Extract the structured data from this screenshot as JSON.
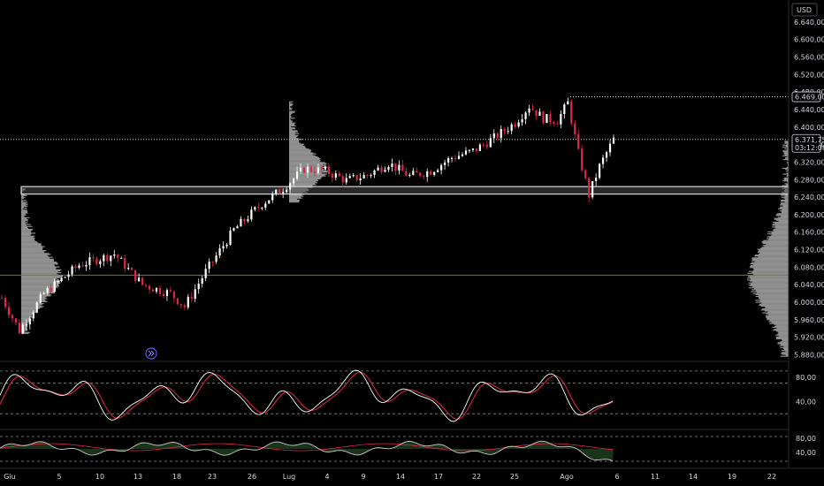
{
  "currency_button": "USD",
  "colors": {
    "background": "#000000",
    "up": "#ffffff",
    "down": "#e0274a",
    "volume_profile": "#bdbdbd",
    "poc_line": "#7a7a2a",
    "stoch_k": "#ffffff",
    "stoch_d": "#e0274a",
    "osc2_line": "#c8c8c8",
    "osc2_signal": "#e0274a",
    "osc2_fill": "#1d3a1d",
    "axis_text": "#d1d4dc"
  },
  "chart_data": [
    {
      "type": "candlestick",
      "title": "",
      "x_tick_labels": [
        "Giu",
        "5",
        "10",
        "13",
        "18",
        "23",
        "26",
        "Lug",
        "4",
        "9",
        "14",
        "17",
        "22",
        "25",
        "Ago",
        "6",
        "11",
        "14",
        "19",
        "22"
      ],
      "y_tick_labels": [
        "6.640,00",
        "6.600,00",
        "6.560,00",
        "6.520,00",
        "6.480,00",
        "6.440,00",
        "6.400,00",
        "6.360,00",
        "6.320,00",
        "6.280,00",
        "6.240,00",
        "6.200,00",
        "6.160,00",
        "6.120,00",
        "6.080,00",
        "6.040,00",
        "6.000,00",
        "5.960,00",
        "5.920,00",
        "5.880,00"
      ],
      "y_ticks": [
        6640,
        6600,
        6560,
        6520,
        6480,
        6440,
        6400,
        6360,
        6320,
        6280,
        6240,
        6200,
        6160,
        6120,
        6080,
        6040,
        6000,
        5960,
        5920,
        5880
      ],
      "ylim": [
        5867,
        6690
      ],
      "reference_lines": [
        {
          "value": 6469,
          "label": "6.469,00",
          "style": "dotted"
        },
        {
          "value": 6371.75,
          "label": "6.371,75",
          "sublabel": "03:12:08",
          "style": "dotted"
        }
      ],
      "value_area_band": [
        6247,
        6264
      ],
      "poc_level": 6062,
      "anchors": [
        {
          "i": 0,
          "p": 6010
        },
        {
          "i": 5,
          "p": 5935
        },
        {
          "i": 12,
          "p": 6020
        },
        {
          "i": 22,
          "p": 6085
        },
        {
          "i": 32,
          "p": 6110
        },
        {
          "i": 40,
          "p": 6040
        },
        {
          "i": 48,
          "p": 6020
        },
        {
          "i": 52,
          "p": 5990
        },
        {
          "i": 58,
          "p": 6070
        },
        {
          "i": 66,
          "p": 6165
        },
        {
          "i": 74,
          "p": 6225
        },
        {
          "i": 80,
          "p": 6260
        },
        {
          "i": 86,
          "p": 6305
        },
        {
          "i": 92,
          "p": 6300
        },
        {
          "i": 98,
          "p": 6278
        },
        {
          "i": 104,
          "p": 6290
        },
        {
          "i": 110,
          "p": 6318
        },
        {
          "i": 116,
          "p": 6288
        },
        {
          "i": 122,
          "p": 6300
        },
        {
          "i": 128,
          "p": 6330
        },
        {
          "i": 134,
          "p": 6345
        },
        {
          "i": 140,
          "p": 6375
        },
        {
          "i": 146,
          "p": 6410
        },
        {
          "i": 150,
          "p": 6448
        },
        {
          "i": 154,
          "p": 6420
        },
        {
          "i": 158,
          "p": 6415
        },
        {
          "i": 161,
          "p": 6455
        },
        {
          "i": 164,
          "p": 6340
        },
        {
          "i": 167,
          "p": 6245
        },
        {
          "i": 170,
          "p": 6310
        },
        {
          "i": 174,
          "p": 6372
        }
      ]
    },
    {
      "type": "line",
      "title": "",
      "y_tick_labels": [
        "80,00",
        "40,00"
      ],
      "y_ticks": [
        80,
        40
      ],
      "ylim": [
        0,
        100
      ],
      "bands": [
        90,
        70,
        20
      ]
    },
    {
      "type": "area",
      "title": "",
      "y_tick_labels": [
        "80,00",
        "40,00"
      ],
      "y_ticks": [
        80,
        40
      ],
      "ylim": [
        0,
        100
      ],
      "bands": [
        85,
        15
      ]
    }
  ]
}
